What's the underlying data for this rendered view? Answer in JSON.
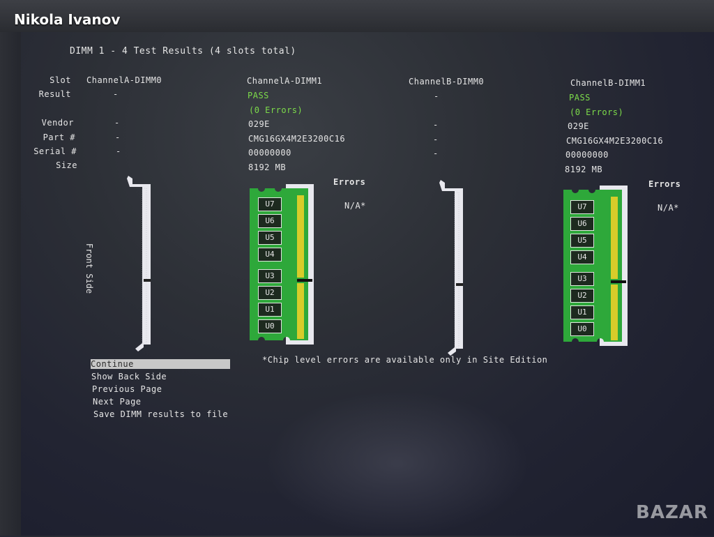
{
  "watermark": {
    "name": "Nikola Ivanov",
    "logo": "BAZAR"
  },
  "title": "DIMM 1 - 4 Test Results (4 slots total)",
  "labels": {
    "slot": "Slot",
    "result": "Result",
    "vendor": "Vendor",
    "part": "Part #",
    "serial": "Serial #",
    "size": "Size"
  },
  "dimms": [
    {
      "slot": "ChannelA-DIMM0",
      "result": "-",
      "vendor": "-",
      "part": "-",
      "serial": "-",
      "size": ""
    },
    {
      "slot": "ChannelA-DIMM1",
      "result": "PASS",
      "errors_count": "(0 Errors)",
      "vendor": "029E",
      "part": "CMG16GX4M2E3200C16",
      "serial": "00000000",
      "size": "8192 MB"
    },
    {
      "slot": "ChannelB-DIMM0",
      "result": "-",
      "vendor": "-",
      "part": "-",
      "serial": "-",
      "size": ""
    },
    {
      "slot": "ChannelB-DIMM1",
      "result": "PASS",
      "errors_count": "(0 Errors)",
      "vendor": "029E",
      "part": "CMG16GX4M2E3200C16",
      "serial": "00000000",
      "size": "8192 MB"
    }
  ],
  "errors_header": "Errors",
  "errors_value": "N/A*",
  "chips": [
    "U7",
    "U6",
    "U5",
    "U4",
    "U3",
    "U2",
    "U1",
    "U0"
  ],
  "front_side_label": "Front Side",
  "footnote": "*Chip level errors are available only in Site Edition",
  "menu": [
    "Continue",
    "Show Back Side",
    "Previous Page",
    "Next Page",
    "Save DIMM results to file"
  ],
  "colors": {
    "pcb_green": "#2ea83a",
    "chip_dark": "#1d2a1f",
    "gold_contacts": "#d7cc2a",
    "pass_green": "#7ddc4a",
    "slot_white": "#e8e8ee"
  }
}
